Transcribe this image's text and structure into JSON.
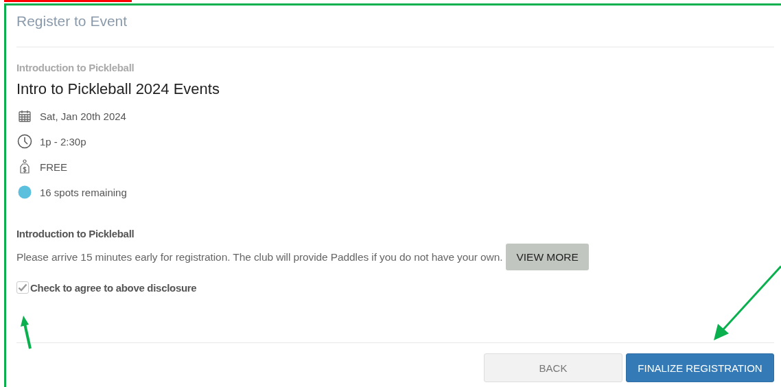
{
  "dialog": {
    "title": "Register to Event"
  },
  "event": {
    "category": "Introduction to Pickleball",
    "name": "Intro to Pickleball 2024 Events",
    "details": [
      {
        "kind": "date",
        "text": "Sat, Jan 20th 2024"
      },
      {
        "kind": "time",
        "text": "1p - 2:30p"
      },
      {
        "kind": "price",
        "text": "FREE"
      },
      {
        "kind": "spots",
        "text": "16 spots remaining"
      }
    ]
  },
  "description": {
    "heading": "Introduction to Pickleball",
    "text": "Please arrive 15 minutes early for registration. The club will provide Paddles if you do not have your own.",
    "button": "VIEW MORE"
  },
  "agreement": {
    "label": "Check to agree to above disclosure",
    "checked": true
  },
  "buttons": [
    {
      "kind": "secondary",
      "label": "BACK"
    },
    {
      "kind": "primary",
      "label": "FINALIZE REGISTRATION"
    }
  ]
}
